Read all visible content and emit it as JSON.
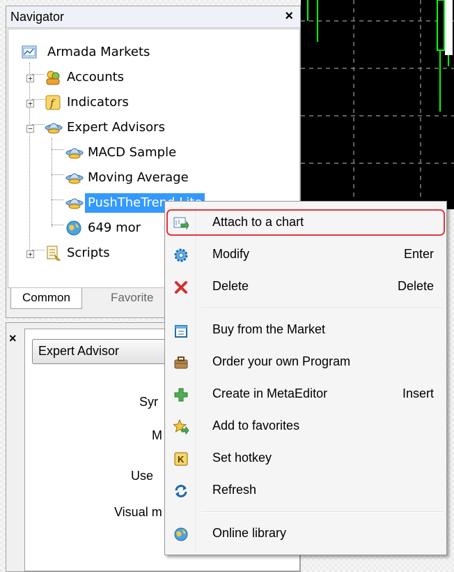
{
  "navigator": {
    "title": "Navigator",
    "close": "×",
    "tree": [
      {
        "label": "Armada Markets",
        "icon": "broker-icon"
      },
      {
        "label": "Accounts",
        "icon": "accounts-icon"
      },
      {
        "label": "Indicators",
        "icon": "indicators-icon"
      },
      {
        "label": "Expert Advisors",
        "icon": "expert-advisors-icon"
      },
      {
        "label": "MACD Sample",
        "icon": "expert-icon"
      },
      {
        "label": "Moving Average",
        "icon": "expert-icon"
      },
      {
        "label": "PushTheTrend Lite",
        "icon": "expert-icon",
        "selected": true
      },
      {
        "label": "649 mor",
        "icon": "globe-icon"
      },
      {
        "label": "Scripts",
        "icon": "scripts-icon"
      }
    ],
    "tabs": [
      "Common",
      "Favorite"
    ]
  },
  "bottom_panel": {
    "close": "×",
    "combo_value": "Expert Advisor",
    "labels": [
      "Syr",
      "M",
      "Use",
      "Visual m"
    ]
  },
  "context_menu": {
    "items": [
      {
        "label": "Attach to a chart",
        "shortcut": "",
        "icon": "attach-chart-icon",
        "highlighted": true
      },
      {
        "label": "Modify",
        "shortcut": "Enter",
        "icon": "gear-icon"
      },
      {
        "label": "Delete",
        "shortcut": "Delete",
        "icon": "delete-icon"
      },
      {
        "label": "Buy from the Market",
        "shortcut": "",
        "icon": "market-icon"
      },
      {
        "label": "Order your own Program",
        "shortcut": "",
        "icon": "briefcase-icon"
      },
      {
        "label": "Create in MetaEditor",
        "shortcut": "Insert",
        "icon": "plus-icon"
      },
      {
        "label": "Add to favorites",
        "shortcut": "",
        "icon": "star-icon"
      },
      {
        "label": "Set hotkey",
        "shortcut": "",
        "icon": "hotkey-icon"
      },
      {
        "label": "Refresh",
        "shortcut": "",
        "icon": "refresh-icon"
      },
      {
        "label": "Online library",
        "shortcut": "",
        "icon": "globe-icon"
      }
    ]
  },
  "colors": {
    "highlight_border": "#e8323a",
    "selection": "#3399ff",
    "chart_bg": "#000000",
    "candle_green": "#00ff00"
  }
}
